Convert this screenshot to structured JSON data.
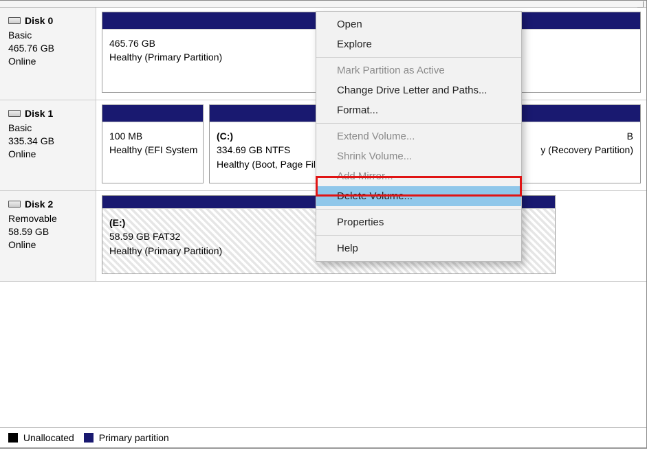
{
  "disks": [
    {
      "title": "Disk 0",
      "type": "Basic",
      "size": "465.76 GB",
      "status": "Online",
      "partitions": [
        {
          "label": "",
          "size": "465.76 GB",
          "fs": "",
          "health": "Healthy (Primary Partition)"
        }
      ]
    },
    {
      "title": "Disk 1",
      "type": "Basic",
      "size": "335.34 GB",
      "status": "Online",
      "partitions": [
        {
          "label": "",
          "size": "100 MB",
          "fs": "",
          "health": "Healthy (EFI System"
        },
        {
          "label": "(C:)",
          "size": "334.69 GB NTFS",
          "fs": "",
          "health": "Healthy (Boot, Page Fil"
        },
        {
          "label": "",
          "size": "B",
          "fs": "",
          "health": "y (Recovery Partition)"
        }
      ]
    },
    {
      "title": "Disk 2",
      "type": "Removable",
      "size": "58.59 GB",
      "status": "Online",
      "partitions": [
        {
          "label": "(E:)",
          "size": "58.59 GB FAT32",
          "fs": "",
          "health": "Healthy (Primary Partition)"
        }
      ]
    }
  ],
  "legend": {
    "unallocated": "Unallocated",
    "primary": "Primary partition"
  },
  "menu": {
    "open": "Open",
    "explore": "Explore",
    "mark_active": "Mark Partition as Active",
    "change_letter": "Change Drive Letter and Paths...",
    "format": "Format...",
    "extend": "Extend Volume...",
    "shrink": "Shrink Volume...",
    "add_mirror": "Add Mirror...",
    "delete": "Delete Volume...",
    "properties": "Properties",
    "help": "Help"
  }
}
